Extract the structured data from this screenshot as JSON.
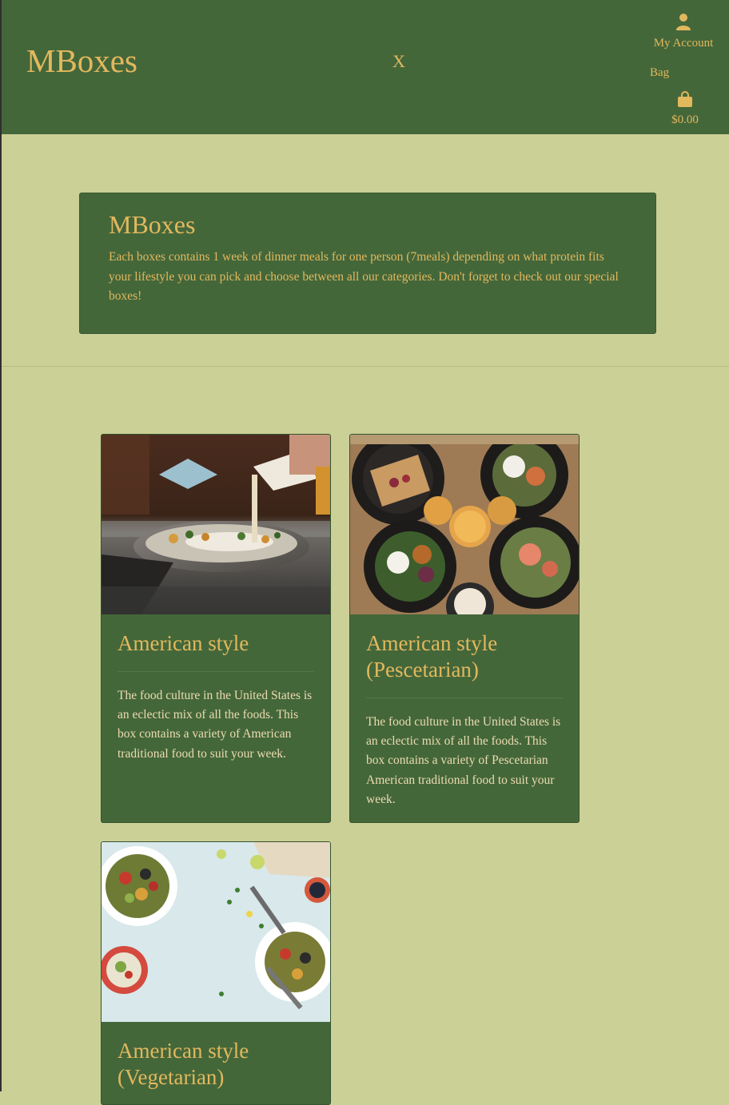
{
  "header": {
    "logo": "MBoxes",
    "close_label": "X",
    "account_icon": "user-icon",
    "account_label": "My Account",
    "bag_label": "Bag",
    "bag_icon": "shopping-bag-icon",
    "bag_total": "$0.00"
  },
  "intro": {
    "title": "MBoxes",
    "text": "Each boxes contains 1 week of dinner meals for one person (7meals) depending on what protein fits your lifestyle you can pick and choose between all our categories. Don't forget to check out our special boxes!"
  },
  "products": [
    {
      "title": "American style",
      "text": "The food culture in the United States is an eclectic mix of all the foods. This box contains a variety of American traditional food to suit your week.",
      "image": "pan-cooking-photo"
    },
    {
      "title": "American style (Pescetarian)",
      "text": "The food culture in the United States is an eclectic mix of all the foods. This box contains a variety of Pescetarian American traditional food to suit your week.",
      "image": "dinner-plates-photo"
    },
    {
      "title": "American style (Vegetarian)",
      "text": "",
      "image": "salad-bowls-photo"
    }
  ],
  "colors": {
    "header_bg": "#44673a",
    "page_bg": "#cbd096",
    "accent": "#e2b85d"
  }
}
